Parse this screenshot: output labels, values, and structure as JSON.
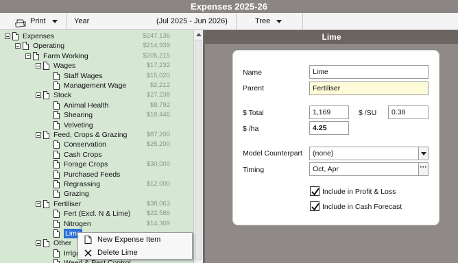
{
  "window": {
    "title": "Expenses 2025-26"
  },
  "toolbar": {
    "print_label": "Print",
    "year_label": "Year",
    "year_value": "2025",
    "year_range": "(Jul 2025 - Jun 2026)",
    "view_label": "Tree"
  },
  "tree": {
    "rows": [
      {
        "name": "Expenses",
        "amount": "$247,136",
        "level": 0,
        "expander": true
      },
      {
        "name": "Operating",
        "amount": "$214,939",
        "level": 1,
        "expander": true
      },
      {
        "name": "Farm Working",
        "amount": "$205,215",
        "level": 2,
        "expander": true
      },
      {
        "name": "Wages",
        "amount": "$17,232",
        "level": 3,
        "expander": true
      },
      {
        "name": "Staff Wages",
        "amount": "$15,020",
        "level": 4,
        "expander": false
      },
      {
        "name": "Management Wage",
        "amount": "$2,212",
        "level": 4,
        "expander": false
      },
      {
        "name": "Stock",
        "amount": "$27,238",
        "level": 3,
        "expander": true
      },
      {
        "name": "Animal Health",
        "amount": "$8,792",
        "level": 4,
        "expander": false
      },
      {
        "name": "Shearing",
        "amount": "$18,446",
        "level": 4,
        "expander": false
      },
      {
        "name": "Velveting",
        "amount": "",
        "level": 4,
        "expander": false
      },
      {
        "name": "Feed, Crops & Grazing",
        "amount": "$87,200",
        "level": 3,
        "expander": true
      },
      {
        "name": "Conservation",
        "amount": "$25,200",
        "level": 4,
        "expander": false
      },
      {
        "name": "Cash Crops",
        "amount": "",
        "level": 4,
        "expander": false
      },
      {
        "name": "Forage Crops",
        "amount": "$30,000",
        "level": 4,
        "expander": false
      },
      {
        "name": "Purchased Feeds",
        "amount": "",
        "level": 4,
        "expander": false
      },
      {
        "name": "Regrassing",
        "amount": "$12,000",
        "level": 4,
        "expander": false
      },
      {
        "name": "Grazing",
        "amount": "",
        "level": 4,
        "expander": false
      },
      {
        "name": "Fertiliser",
        "amount": "$38,063",
        "level": 3,
        "expander": true
      },
      {
        "name": "Fert (Excl. N & Lime)",
        "amount": "$22,586",
        "level": 4,
        "expander": false
      },
      {
        "name": "Nitrogen",
        "amount": "$14,309",
        "level": 4,
        "expander": false
      },
      {
        "name": "Lime",
        "amount": "",
        "level": 4,
        "expander": false,
        "selected": true
      },
      {
        "name": "Other",
        "amount": "",
        "level": 3,
        "expander": true
      },
      {
        "name": "Irrigation",
        "amount": "",
        "level": 4,
        "expander": false
      },
      {
        "name": "Weed & Pest Control",
        "amount": "",
        "level": 4,
        "expander": false
      }
    ]
  },
  "context_menu": {
    "items": [
      {
        "label": "New Expense Item",
        "icon": "new-document-icon"
      },
      {
        "label": "Delete Lime",
        "icon": "delete-cross-icon"
      }
    ]
  },
  "detail": {
    "title": "Lime",
    "name_label": "Name",
    "name_value": "Lime",
    "parent_label": "Parent",
    "parent_value": "Fertiliser",
    "total_label": "$ Total",
    "total_value": "1,169",
    "per_su_label": "$ /SU",
    "per_su_value": "0.38",
    "per_ha_label": "$ /ha",
    "per_ha_value": "4.25",
    "model_label": "Model Counterpart",
    "model_value": "(none)",
    "timing_label": "Timing",
    "timing_value": "Oct, Apr",
    "include_pl_label": "Include in Profit & Loss",
    "include_pl_checked": true,
    "include_cf_label": "Include in Cash Forecast",
    "include_cf_checked": true
  },
  "colors": {
    "tree_background": "#d6e7d4",
    "selection": "#2a6fd6",
    "title_bar": "#8b8684",
    "detail_header": "#6b6461",
    "parent_field": "#fdfbd8"
  }
}
